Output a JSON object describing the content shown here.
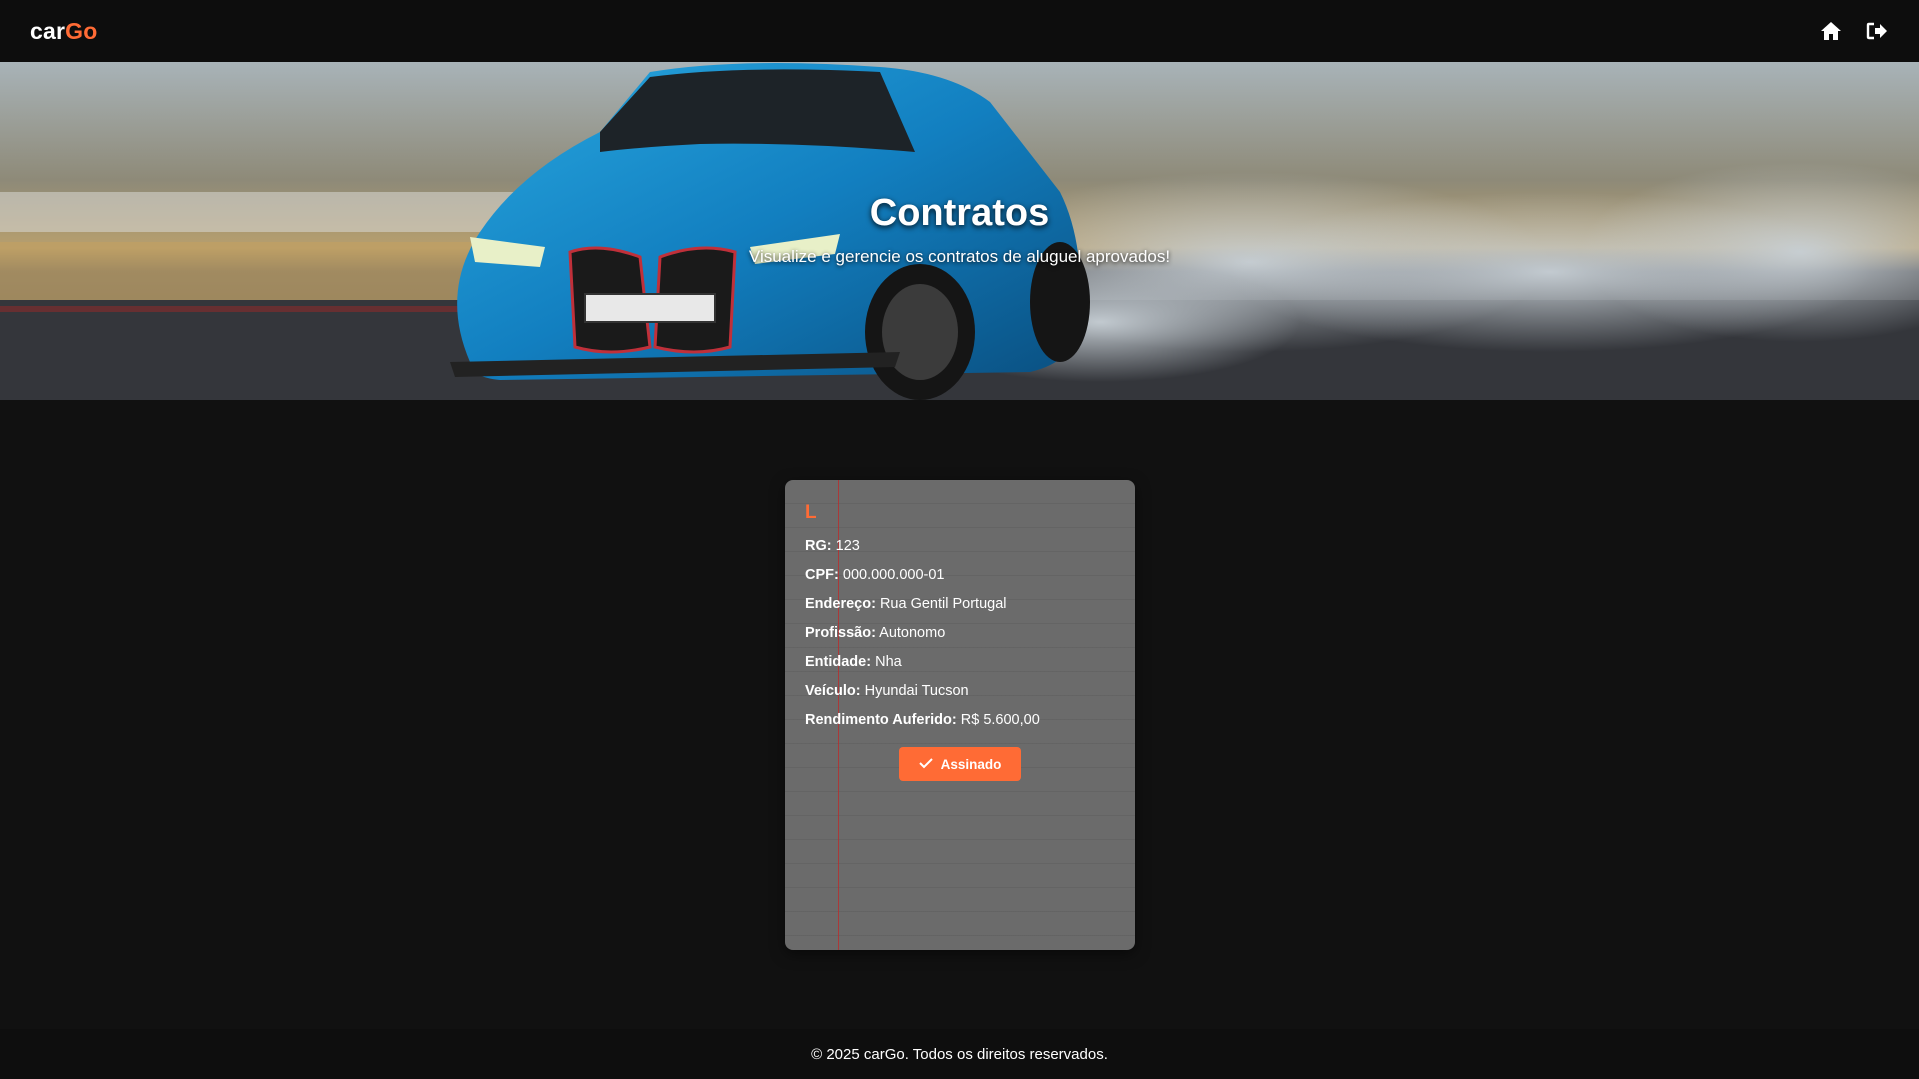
{
  "brand": {
    "logo_part1": "car",
    "logo_part2": "Go"
  },
  "nav": {
    "icons": [
      "home-icon",
      "logout-icon"
    ]
  },
  "hero": {
    "title": "Contratos",
    "subtitle": "Visualize e gerencie os contratos de aluguel aprovados!"
  },
  "contract": {
    "initial": "L",
    "fields": [
      {
        "label": "RG:",
        "value": "123"
      },
      {
        "label": "CPF:",
        "value": "000.000.000-01"
      },
      {
        "label": "Endereço:",
        "value": "Rua Gentil Portugal"
      },
      {
        "label": "Profissão:",
        "value": "Autonomo"
      },
      {
        "label": "Entidade:",
        "value": "Nha"
      },
      {
        "label": "Veículo:",
        "value": "Hyundai Tucson"
      },
      {
        "label": "Rendimento Auferido:",
        "value": "R$ 5.600,00"
      }
    ],
    "status_label": "Assinado",
    "status_icon": "check-icon"
  },
  "footer": {
    "text": "© 2025 carGo. Todos os direitos reservados."
  },
  "colors": {
    "accent": "#ff6b35",
    "background": "#111111",
    "card": "#6b6b6b"
  }
}
